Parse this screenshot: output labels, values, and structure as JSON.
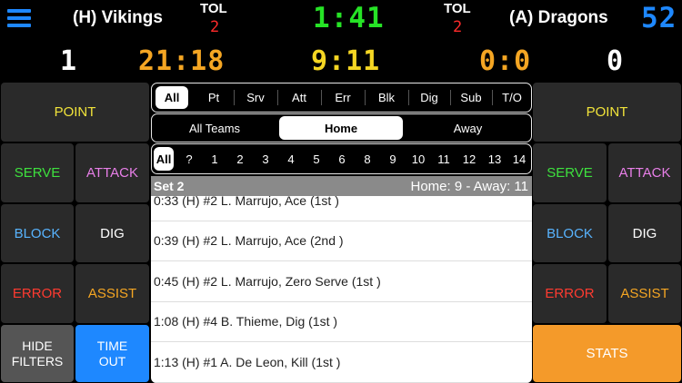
{
  "header": {
    "menu_icon": "hamburger-menu-icon",
    "home_team": "(H) Vikings",
    "away_team": "(A) Dragons",
    "home_tol_label": "TOL",
    "home_tol_value": "2",
    "away_tol_label": "TOL",
    "away_tol_value": "2",
    "clock": "1:41",
    "shot_clock": "52",
    "home_sets": "1",
    "home_score": "21:18",
    "center_score": "9:11",
    "away_score_small": "0:0",
    "away_sets": "0"
  },
  "left_buttons": {
    "point": "POINT",
    "serve": "SERVE",
    "attack": "ATTACK",
    "block": "BLOCK",
    "dig": "DIG",
    "error": "ERROR",
    "assist": "ASSIST",
    "hide_filters_1": "HIDE",
    "hide_filters_2": "FILTERS",
    "timeout_1": "TIME",
    "timeout_2": "OUT"
  },
  "right_buttons": {
    "point": "POINT",
    "serve": "SERVE",
    "attack": "ATTACK",
    "block": "BLOCK",
    "dig": "DIG",
    "error": "ERROR",
    "assist": "ASSIST",
    "stats": "STATS"
  },
  "stat_filters": [
    "All",
    "Pt",
    "Srv",
    "Att",
    "Err",
    "Blk",
    "Dig",
    "Sub",
    "T/O"
  ],
  "team_filters": [
    "All Teams",
    "Home",
    "Away"
  ],
  "player_filters": [
    "All",
    "?",
    "1",
    "2",
    "3",
    "4",
    "5",
    "6",
    "8",
    "9",
    "10",
    "11",
    "12",
    "13",
    "14"
  ],
  "set_header": {
    "title": "Set 2",
    "score": "Home: 9 - Away: 11"
  },
  "events": [
    "0:33 (H) #2 L. Marrujo, Ace (1st )",
    "0:39 (H) #2 L. Marrujo, Ace (2nd )",
    "0:45 (H) #2 L. Marrujo, Zero Serve (1st )",
    "1:08 (H) #4 B. Thieme, Dig (1st )",
    "1:13 (H) #1 A. De Leon, Kill (1st )"
  ],
  "colors": {
    "point": "#f2e43a",
    "serve": "#3ee13e",
    "attack": "#e87fe8",
    "block": "#58b4ff",
    "dig": "#ffffff",
    "error": "#ff3b30",
    "assist": "#f5a623",
    "timeout_bg": "#1e88ff",
    "stats_bg": "#f49a2a",
    "clock": "#26e326",
    "score": "#f5a623",
    "tol": "#ff2a2a"
  }
}
